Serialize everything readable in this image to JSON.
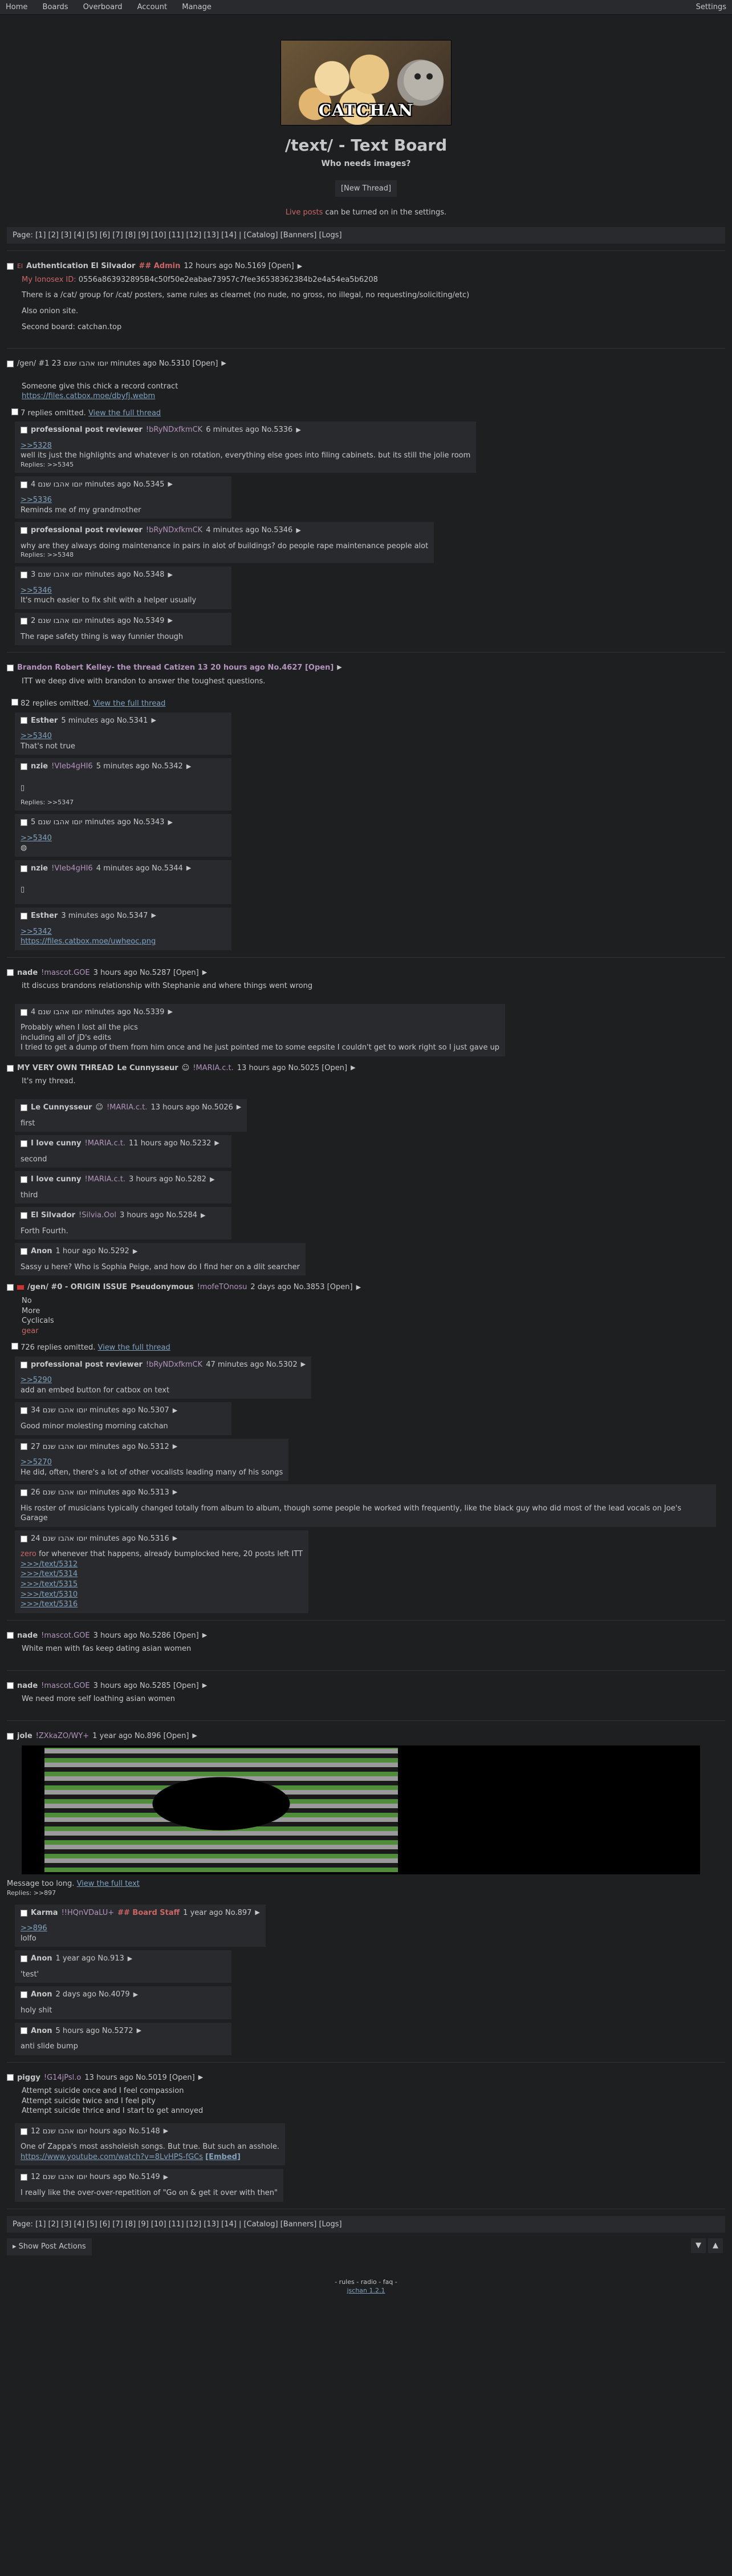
{
  "topbar": {
    "nav": [
      "Home",
      "Boards",
      "Overboard",
      "Account",
      "Manage"
    ],
    "settings": "Settings"
  },
  "header": {
    "banner_caption": "CATCHAN",
    "title": "/text/ - Text Board",
    "subtitle": "Who needs images?",
    "new_thread": "[New Thread]",
    "notice_red": "Live posts",
    "notice_rest": " can be turned on in the settings."
  },
  "pager": "Page: [1] [2] [3] [4] [5] [6] [7] [8] [9] [10] [11] [12] [13] [14] | [Catalog] [Banners] [Logs]",
  "threads": {
    "t1": {
      "flag_text": "El",
      "subject": "Authentication El Silvador",
      "cap": "## Admin",
      "meta": "12 hours ago No.5169 [Open]",
      "id_label": "My Ionosex ID:",
      "id_value": "0556a863932895B4c50f50e2eabae73957c7fee36538362384b2e4a54ea5b6208",
      "lines": [
        "There is a /cat/ group for /cat/ posters, same rules as clearnet (no nude, no gross, no illegal, no requesting/soliciting/etc)",
        "Also onion site.",
        "Second board: catchan.top"
      ]
    },
    "t2": {
      "head": "/gen/ #1 23 יוםו אהבו שנם minutes ago No.5310 [Open]",
      "op_lines": [
        "Someone give this chick a record contract",
        "https://files.catbox.moe/dbyfj.webm"
      ],
      "omitted": "7 replies omitted.",
      "view_full": "View the full thread",
      "replies": [
        {
          "name": "professional post reviewer",
          "trip": "!bRyNDxfkmCK",
          "meta": "6 minutes ago No.5336",
          "quote": ">>5328",
          "text": "well its just the highlights and whatever is on rotation, everything else goes into filing cabinets. but its still the jolie room",
          "backlink": "Replies: >>5345"
        },
        {
          "name": "",
          "trip": "",
          "meta": "4 יוםו אהבו שנם minutes ago No.5345",
          "quote": ">>5336",
          "text": "Reminds me of my grandmother",
          "backlink": ""
        },
        {
          "name": "professional post reviewer",
          "trip": "!bRyNDxfkmCK",
          "meta": "4 minutes ago No.5346",
          "quote": "",
          "text": "why are they always doing maintenance in pairs in alot of buildings? do people rape maintenance people alot",
          "backlink": "Replies: >>5348"
        },
        {
          "name": "",
          "trip": "",
          "meta": "3 יוםו אהבו שנם minutes ago No.5348",
          "quote": ">>5346",
          "text": "It's much easier to fix shit with a helper usually",
          "backlink": ""
        },
        {
          "name": "",
          "trip": "",
          "meta": "2 יוםו אהבו שנם minutes ago No.5349",
          "quote": "",
          "text": "The rape safety thing is way funnier though",
          "backlink": ""
        }
      ]
    },
    "t3": {
      "head": "Brandon Robert Kelley- the thread Catizen 13 20 hours ago No.4627 [Open]",
      "op_text": "ITT we deep dive with brandon to answer the toughest questions.",
      "omitted": "82 replies omitted.",
      "view_full": "View the full thread",
      "replies": [
        {
          "name": "Esther",
          "trip": "",
          "meta": "5 minutes ago No.5341",
          "quote": ">>5340",
          "text": "That's not true",
          "backlink": ""
        },
        {
          "name": "nzie",
          "trip": "!VIeb4gHI6",
          "meta": "5 minutes ago No.5342",
          "quote": "",
          "text": "",
          "backlink": "Replies: >>5347"
        },
        {
          "name": "",
          "trip": "",
          "meta": "5 יוםו אהבו שנם minutes ago No.5343",
          "quote": ">>5340",
          "text": "",
          "backlink": ""
        },
        {
          "name": "nzie",
          "trip": "!VIeb4gHI6",
          "meta": "4 minutes ago No.5344",
          "quote": "",
          "text": "",
          "backlink": ""
        },
        {
          "name": "Esther",
          "trip": "",
          "meta": "3 minutes ago No.5347",
          "quote": ">>5342",
          "text": "https://files.catbox.moe/uwheoc.png",
          "backlink": ""
        }
      ]
    },
    "t4": {
      "name": "nade",
      "trip": "!mascot.GOE",
      "meta": "3 hours ago No.5287 [Open]",
      "op_text": "itt discuss brandons relationship with Stephanie and where things went wrong",
      "reply_meta": "4 יוםו אהבו שנם minutes ago No.5339",
      "reply_lines": [
        "Probably when I lost all the pics",
        "including all of jD's edits",
        "I tried to get a dump of them from him once and he just pointed me to some eepsite I couldn't get to work right so I just gave up"
      ]
    },
    "t5": {
      "subject": "MY VERY OWN THREAD",
      "name": "Le Cunnysseur",
      "trip": "!MARIA.c.t.",
      "meta": "13 hours ago No.5025 [Open]",
      "op_text": "It's my thread.",
      "replies": [
        {
          "name": "Le Cunnysseur",
          "trip": "!MARIA.c.t.",
          "meta": "13 hours ago No.5026",
          "text": "first"
        },
        {
          "name": "I love cunny",
          "trip": "!MARIA.c.t.",
          "meta": "11 hours ago No.5232",
          "text": "second"
        },
        {
          "name": "I love cunny",
          "trip": "!MARIA.c.t.",
          "meta": "3 hours ago No.5282",
          "text": "third"
        },
        {
          "name": "El Silvador",
          "trip": "!Silvia.Ool",
          "meta": "3 hours ago No.5284",
          "text": "Forth Fourth."
        },
        {
          "name": "Anon",
          "trip": "",
          "meta": "1 hour ago No.5292",
          "text": "Sassy u here? Who is Sophia Peige, and how do I find her on a dlit searcher"
        }
      ]
    },
    "t6": {
      "subject": "/gen/ #0 - ORIGIN ISSUE",
      "name": "Pseudonymous",
      "trip": "!mofeTOnosu",
      "meta": "2 days ago No.3853 [Open]",
      "op_lines": [
        "No",
        "More",
        "Cyclicals"
      ],
      "op_red": "gear",
      "omitted": "726 replies omitted.",
      "view_full": "View the full thread",
      "replies": [
        {
          "name": "professional post reviewer",
          "trip": "!bRyNDxfkmCK",
          "meta": "47 minutes ago No.5302",
          "quote": ">>5290",
          "text": "add an embed button for catbox on text"
        },
        {
          "name": "",
          "trip": "",
          "meta": "34 יוםו אהבו שנם minutes ago No.5307",
          "quote": "",
          "text": "Good minor molesting morning catchan"
        },
        {
          "name": "",
          "trip": "",
          "meta": "27 יוםו אהבו שנם minutes ago No.5312",
          "quote": ">>5270",
          "text": "He did, often, there's a lot of other vocalists leading many of his songs"
        },
        {
          "name": "",
          "trip": "",
          "meta": "26 יוםו אהבו שנם minutes ago No.5313",
          "quote": "",
          "text": "His roster of musicians typically changed totally from album to album, though some people he worked with frequently, like the black guy who did most of the lead vocals on Joe's Garage"
        }
      ],
      "bump_meta": "24 יוםו אהבו שנם minutes ago No.5316",
      "bump_red": "zero",
      "bump_text": " for whenever that happens, already bumplocked here, 20 posts left ITT",
      "bump_links": [
        ">>>/text/5312",
        ">>>/text/5314",
        ">>>/text/5315",
        ">>>/text/5310",
        ">>>/text/5316"
      ]
    },
    "t7": {
      "name": "nade",
      "trip": "!mascot.GOE",
      "meta": "3 hours ago No.5286 [Open]",
      "text": "White men with fas keep dating asian women"
    },
    "t8": {
      "name": "nade",
      "trip": "!mascot.GOE",
      "meta": "3 hours ago No.5285 [Open]",
      "text": "We need more self loathing asian women"
    },
    "t9": {
      "name": "jole",
      "trip": "!ZXkaZO/WY+",
      "meta": "1 year ago No.896 [Open]",
      "too_long": "Message too long.",
      "view_full": "View the full text",
      "backlink": "Replies: >>897",
      "replies": [
        {
          "name": "Karma",
          "trip": "!!HQnVDaLU+",
          "cap": "## Board Staff",
          "meta": "1 year ago No.897",
          "quote": ">>896",
          "text": "lolfo"
        },
        {
          "name": "Anon",
          "trip": "",
          "cap": "",
          "meta": "1 year ago No.913",
          "quote": "",
          "text": "'test'"
        },
        {
          "name": "Anon",
          "trip": "",
          "cap": "",
          "meta": "2 days ago No.4079",
          "quote": "",
          "text": "holy shit"
        },
        {
          "name": "Anon",
          "trip": "",
          "cap": "",
          "meta": "5 hours ago No.5272",
          "quote": "",
          "text": "anti slide bump"
        }
      ]
    },
    "t10": {
      "name": "piggy",
      "trip": "!G14jPsl.o",
      "meta": "13 hours ago No.5019 [Open]",
      "op_lines": [
        "Attempt suicide once and I feel compassion",
        "Attempt suicide twice and I feel pity",
        "Attempt suicide thrice and I start to get annoyed"
      ],
      "replies": [
        {
          "meta": "12 יוםו אהבו שנם hours ago No.5148",
          "text": "One of Zappa's most assholeish songs. But true. But such an asshole.",
          "link": "https://www.youtube.com/watch?v=8LvHPS-fGCs",
          "embed": "[Embed]"
        },
        {
          "meta": "12 יוםו אהבו שנם hours ago No.5149",
          "text": "I really like the over-over-repetition of \"Go on & get it over with then\"",
          "link": "",
          "embed": ""
        }
      ]
    }
  },
  "footer": {
    "show_actions": "Show Post Actions",
    "links": "- rules - radio - faq -",
    "version": "jschan 1.2.1"
  }
}
